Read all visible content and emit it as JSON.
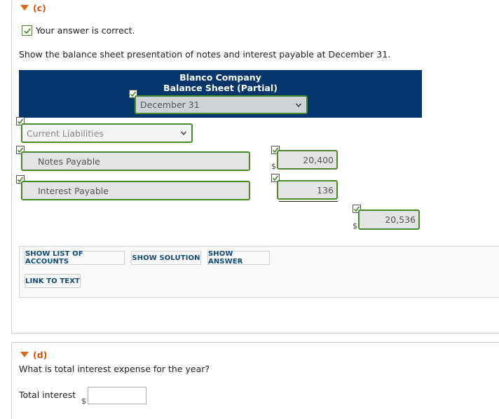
{
  "part_c": {
    "label": "(c)",
    "status": "Your answer is correct.",
    "instruction": "Show the balance sheet presentation of notes and interest payable at December 31.",
    "company": "Blanco Company",
    "statement": "Balance Sheet (Partial)",
    "date_select": "December 31",
    "section_select": "Current Liabilities",
    "rows": [
      {
        "account": "Notes Payable",
        "currency": "$",
        "amount": "20,400"
      },
      {
        "account": "Interest Payable",
        "currency": "",
        "amount": "136"
      }
    ],
    "total_currency": "$",
    "total": "20,536",
    "buttons": {
      "list_accounts": "SHOW LIST OF ACCOUNTS",
      "solution": "SHOW SOLUTION",
      "answer": "SHOW ANSWER",
      "link_text": "LINK TO TEXT"
    }
  },
  "part_d": {
    "label": "(d)",
    "question": "What is total interest expense for the year?",
    "field_label": "Total interest",
    "currency": "$",
    "value": ""
  },
  "colors": {
    "header_bg": "#05366b",
    "correct_green": "#4b8a2c",
    "part_label": "#d2530d"
  }
}
